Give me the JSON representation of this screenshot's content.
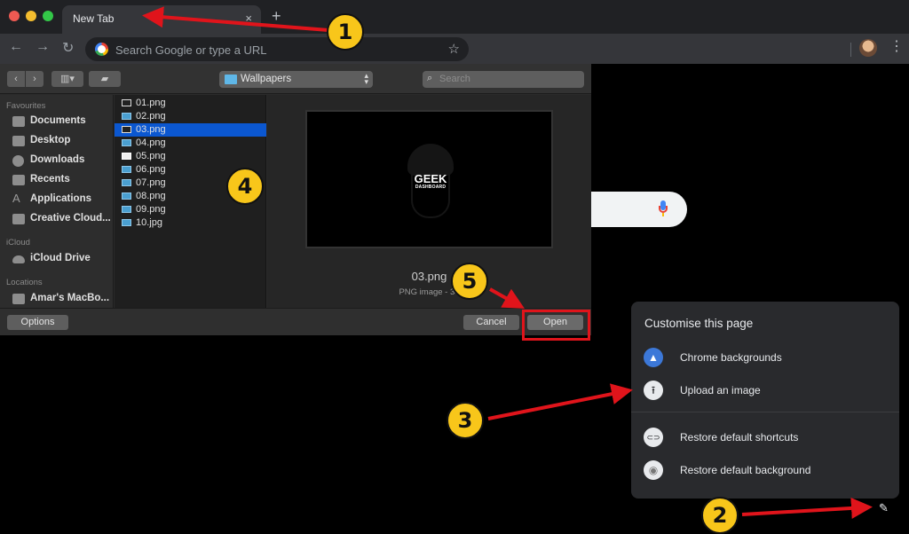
{
  "browser": {
    "tab_title": "New Tab",
    "tab_close": "×",
    "new_tab": "+",
    "back": "←",
    "forward": "→",
    "reload": "↻",
    "omnibox_placeholder": "Search Google or type a URL",
    "star": "☆",
    "menu": "⋮"
  },
  "dialog": {
    "toolbar": {
      "back": "‹",
      "forward": "›",
      "view": "▥▾",
      "new_folder": "▰",
      "location": "Wallpapers",
      "location_arrows": "▴▾",
      "search_icon": "⌕",
      "search_placeholder": "Search"
    },
    "sidebar": {
      "sections": [
        {
          "header": "Favourites",
          "items": [
            {
              "label": "Documents",
              "icon": "documents-icon"
            },
            {
              "label": "Desktop",
              "icon": "desktop-icon"
            },
            {
              "label": "Downloads",
              "icon": "downloads-icon"
            },
            {
              "label": "Recents",
              "icon": "recents-icon"
            },
            {
              "label": "Applications",
              "icon": "applications-icon"
            },
            {
              "label": "Creative Cloud...",
              "icon": "folder-icon"
            }
          ]
        },
        {
          "header": "iCloud",
          "items": [
            {
              "label": "iCloud Drive",
              "icon": "cloud-icon"
            }
          ]
        },
        {
          "header": "Locations",
          "items": [
            {
              "label": "Amar's MacBo...",
              "icon": "laptop-icon"
            }
          ]
        }
      ]
    },
    "files": [
      {
        "name": "01.png",
        "selected": false
      },
      {
        "name": "02.png",
        "selected": false
      },
      {
        "name": "03.png",
        "selected": true
      },
      {
        "name": "04.png",
        "selected": false
      },
      {
        "name": "05.png",
        "selected": false
      },
      {
        "name": "06.png",
        "selected": false
      },
      {
        "name": "07.png",
        "selected": false
      },
      {
        "name": "08.png",
        "selected": false
      },
      {
        "name": "09.png",
        "selected": false
      },
      {
        "name": "10.jpg",
        "selected": false
      }
    ],
    "preview": {
      "logo_main": "GEEK",
      "logo_sub": "DASHBOARD",
      "filename": "03.png",
      "meta": "PNG image - 34"
    },
    "buttons": {
      "options": "Options",
      "cancel": "Cancel",
      "open": "Open"
    }
  },
  "customise_menu": {
    "title": "Customise this page",
    "items": [
      {
        "label": "Chrome backgrounds",
        "icon": "▲"
      },
      {
        "label": "Upload an image",
        "icon": "⭱"
      },
      {
        "label": "Restore default shortcuts",
        "icon": "⊂⊃"
      },
      {
        "label": "Restore default background",
        "icon": "◉"
      }
    ],
    "pencil": "✎"
  },
  "annotations": {
    "step1": "1",
    "step2": "2",
    "step3": "3",
    "step4": "4",
    "step5": "5",
    "arrow_color": "#e0141b",
    "badge_color": "#f8c61a"
  }
}
